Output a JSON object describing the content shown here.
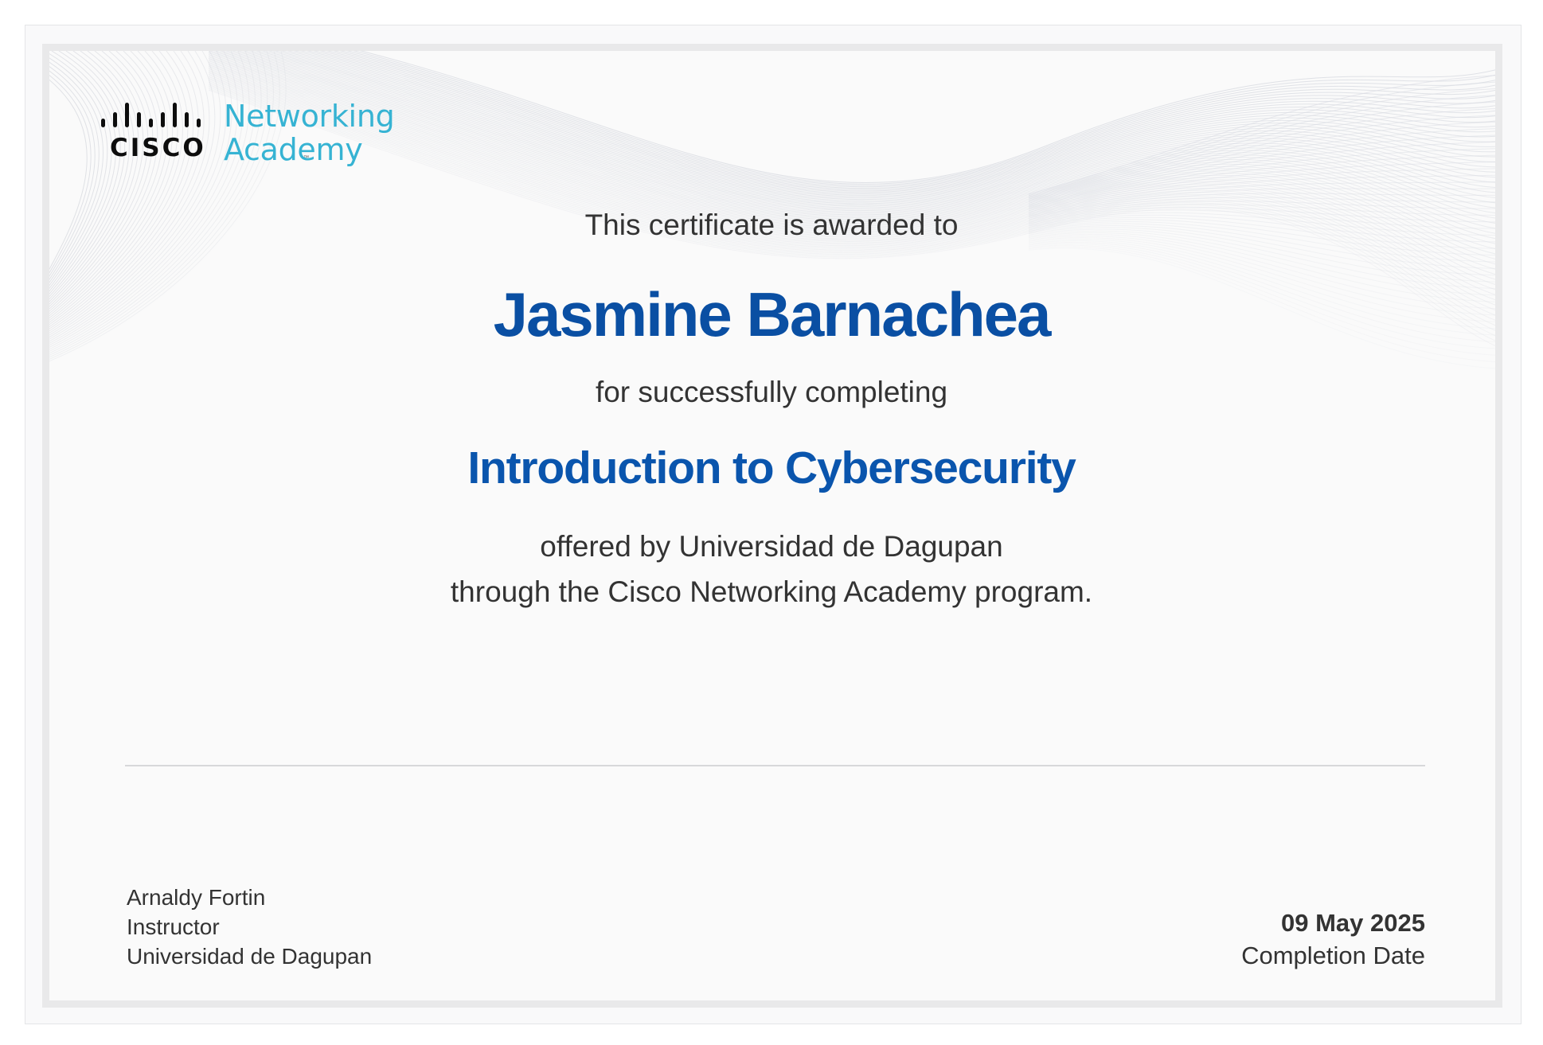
{
  "logo": {
    "wordmark": "CISCO",
    "trademark": "™",
    "program_line1": "Networking",
    "program_line2": "Academy",
    "program_color": "#36b3d3"
  },
  "certificate": {
    "awarded_text": "This certificate is awarded to",
    "recipient_name": "Jasmine Barnachea",
    "completing_text": "for successfully completing",
    "course_title": "Introduction to Cybersecurity",
    "offered_line1": "offered by Universidad de Dagupan",
    "offered_line2": "through the Cisco Networking Academy program.",
    "accent_color": "#0a4fa3"
  },
  "signer": {
    "name": "Arnaldy Fortin",
    "role": "Instructor",
    "organization": "Universidad de Dagupan"
  },
  "completion": {
    "date": "09 May 2025",
    "label": "Completion Date"
  }
}
